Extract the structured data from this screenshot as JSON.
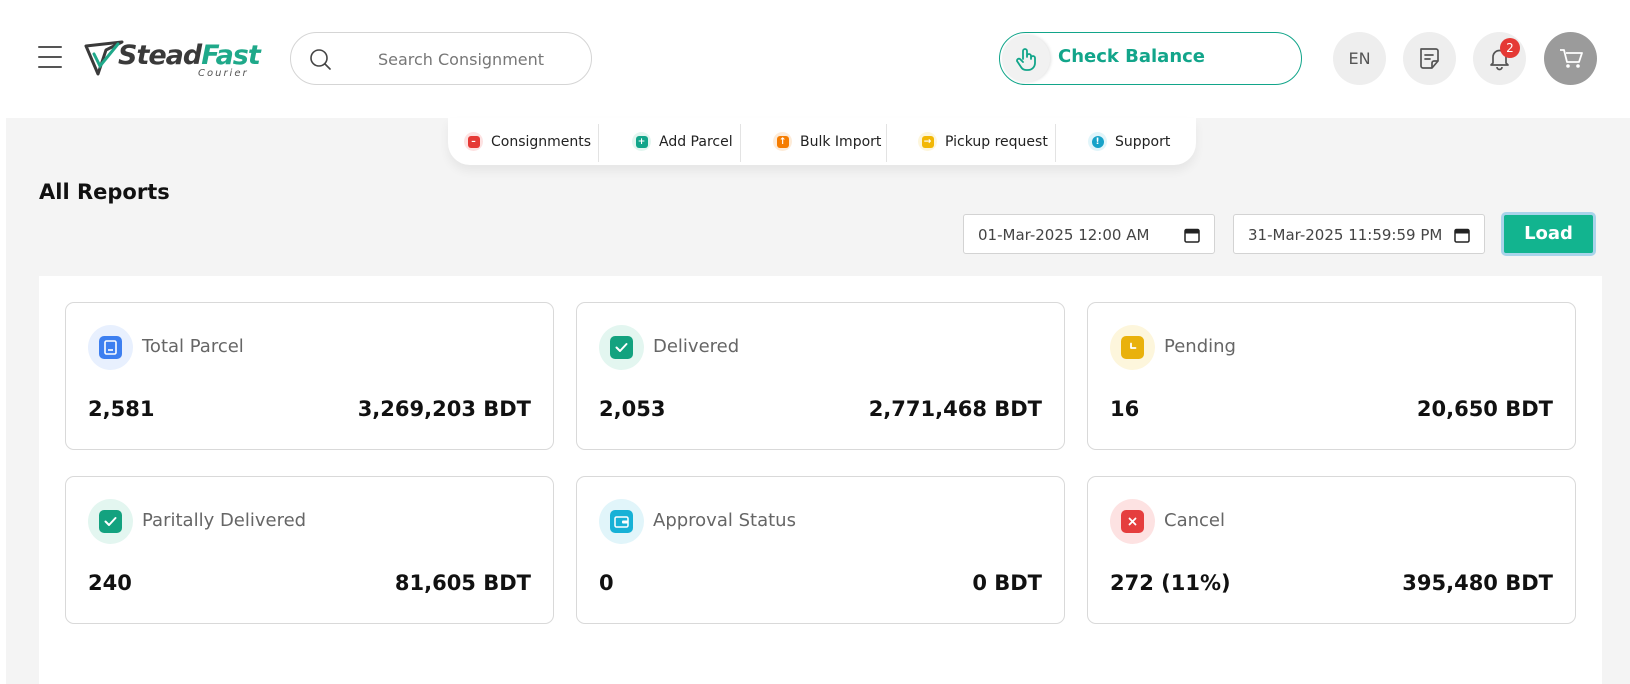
{
  "header": {
    "brand_part1": "Stead",
    "brand_part2": "Fast",
    "brand_sub": "Courier",
    "search_placeholder": "Search Consignment",
    "check_balance_label": "Check Balance",
    "language": "EN",
    "notification_count": "2"
  },
  "nav": {
    "items": [
      {
        "label": "Consignments",
        "color": "#e53935"
      },
      {
        "label": "Add Parcel",
        "color": "#12a58a"
      },
      {
        "label": "Bulk Import",
        "color": "#f57c00"
      },
      {
        "label": "Pickup request",
        "color": "#f2b705"
      },
      {
        "label": "Support",
        "color": "#17a2c8"
      }
    ]
  },
  "page": {
    "title": "All Reports",
    "date_from": "01-Mar-2025 12:00  AM",
    "date_to": "31-Mar-2025 11:59:59  PM",
    "load_label": "Load"
  },
  "cards": [
    {
      "title": "Total Parcel",
      "count": "2,581",
      "amount": "3,269,203 BDT",
      "icon": "parcel-icon",
      "color": "#3d7ff0",
      "bg": "#e8f0fe"
    },
    {
      "title": "Delivered",
      "count": "2,053",
      "amount": "2,771,468 BDT",
      "icon": "check-icon",
      "color": "#13a27f",
      "bg": "#e3f6f0"
    },
    {
      "title": "Pending",
      "count": "16",
      "amount": "20,650 BDT",
      "icon": "clock-icon",
      "color": "#e9b10c",
      "bg": "#fdf6dc"
    },
    {
      "title": "Paritally Delivered",
      "count": "240",
      "amount": "81,605 BDT",
      "icon": "check-icon",
      "color": "#13a27f",
      "bg": "#e3f6f0"
    },
    {
      "title": "Approval Status",
      "count": "0",
      "amount": "0 BDT",
      "icon": "wallet-icon",
      "color": "#17b1d6",
      "bg": "#e1f5fa"
    },
    {
      "title": "Cancel",
      "count": "272 (11%)",
      "amount": "395,480 BDT",
      "icon": "close-icon",
      "color": "#e53e3e",
      "bg": "#fde2e2"
    }
  ]
}
